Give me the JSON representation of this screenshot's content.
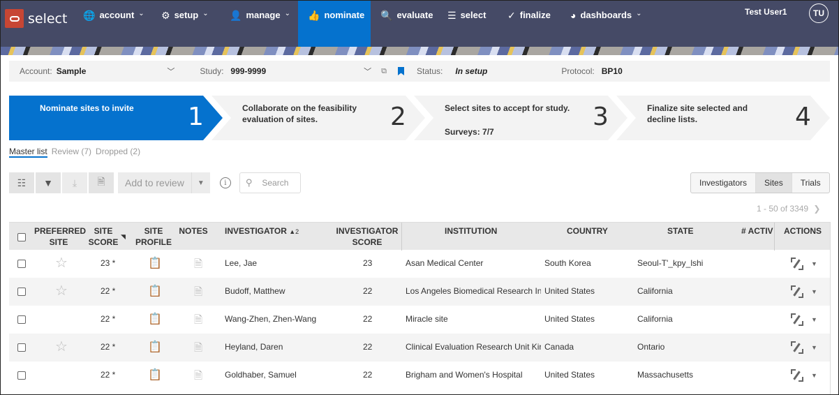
{
  "app": {
    "brand": "select",
    "nav": [
      {
        "icon": "globe-icon",
        "glyph": "🌐",
        "label": "account",
        "has_menu": true
      },
      {
        "icon": "gear-icon",
        "glyph": "⚙",
        "label": "setup",
        "has_menu": true
      },
      {
        "icon": "person-icon",
        "glyph": "👤",
        "label": "manage",
        "has_menu": true
      },
      {
        "icon": "thumbs-up-icon",
        "glyph": "👍",
        "label": "nominate",
        "has_menu": false,
        "active": true
      },
      {
        "icon": "search-icon",
        "glyph": "🔍",
        "label": "evaluate",
        "has_menu": false
      },
      {
        "icon": "list-icon",
        "glyph": "☰",
        "label": "select",
        "has_menu": false
      },
      {
        "icon": "check-circle-icon",
        "glyph": "✓",
        "label": "finalize",
        "has_menu": false
      },
      {
        "icon": "pie-chart-icon",
        "glyph": "◕",
        "label": "dashboards",
        "has_menu": true
      }
    ],
    "user_name": "Test User1",
    "user_initials": "TU",
    "accent_color": "#0572ce",
    "nav_bg": "#454a66"
  },
  "context": {
    "account_label": "Account:",
    "account_value": "Sample",
    "study_label": "Study:",
    "study_value": "999-9999",
    "status_label": "Status:",
    "status_value": "In setup",
    "protocol_label": "Protocol:",
    "protocol_value": "BP10"
  },
  "train": [
    {
      "text": "Nominate sites to invite",
      "number": "1",
      "sub": ""
    },
    {
      "text": "Collaborate on the feasibility evaluation of sites.",
      "number": "2",
      "sub": ""
    },
    {
      "text": "Select sites to accept for study.",
      "number": "3",
      "sub": "Surveys: 7/7"
    },
    {
      "text": "Finalize site selected and decline lists.",
      "number": "4",
      "sub": ""
    }
  ],
  "subtabs": [
    {
      "label": "Master list",
      "active": true
    },
    {
      "label": "Review (7)",
      "active": false
    },
    {
      "label": "Dropped (2)",
      "active": false
    }
  ],
  "toolbar": {
    "add_to_review": "Add to review",
    "search_placeholder": "Search"
  },
  "view_toggle": [
    {
      "label": "Investigators",
      "active": false
    },
    {
      "label": "Sites",
      "active": true
    },
    {
      "label": "Trials",
      "active": false
    }
  ],
  "pager": "1 - 50 of 3349",
  "table": {
    "headers": {
      "preferred_site": [
        "PREFERRED",
        "SITE"
      ],
      "site_score": [
        "SITE",
        "SCORE"
      ],
      "site_profile": [
        "SITE",
        "PROFILE"
      ],
      "notes": "NOTES",
      "investigator": "INVESTIGATOR",
      "investigator_sort": "▲2",
      "investigator_score": [
        "INVESTIGATOR",
        "SCORE"
      ],
      "institution": "INSTITUTION",
      "country": "COUNTRY",
      "state": "STATE",
      "active": "# ACTIV",
      "actions": "ACTIONS"
    },
    "rows": [
      {
        "preferred": true,
        "site_score": "23 *",
        "investigator": "Lee, Jae",
        "investigator_score": "23",
        "institution": "Asan Medical Center",
        "country": "South Korea",
        "state": "Seoul-T'_kpy_lshi"
      },
      {
        "preferred": true,
        "site_score": "22 *",
        "investigator": "Budoff, Matthew",
        "investigator_score": "22",
        "institution": "Los Angeles Biomedical Research In",
        "country": "United States",
        "state": "California"
      },
      {
        "preferred": false,
        "site_score": "22 *",
        "investigator": "Wang-Zhen, Zhen-Wang",
        "investigator_score": "22",
        "institution": "Miracle site",
        "country": "United States",
        "state": "California"
      },
      {
        "preferred": true,
        "site_score": "22 *",
        "investigator": "Heyland, Daren",
        "investigator_score": "22",
        "institution": "Clinical Evaluation Research Unit Kir",
        "country": "Canada",
        "state": "Ontario"
      },
      {
        "preferred": false,
        "site_score": "22 *",
        "investigator": "Goldhaber, Samuel",
        "investigator_score": "22",
        "institution": "Brigham and Women's Hospital",
        "country": "United States",
        "state": "Massachusetts"
      }
    ]
  }
}
